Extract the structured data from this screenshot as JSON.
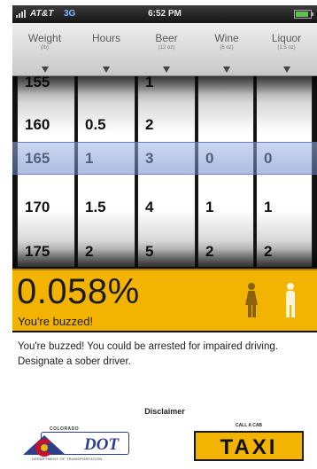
{
  "status_bar": {
    "carrier": "AT&T",
    "network": "3G",
    "time": "6:52 PM"
  },
  "columns": [
    {
      "name": "Weight",
      "unit": "(lb)"
    },
    {
      "name": "Hours",
      "unit": ""
    },
    {
      "name": "Beer",
      "unit": "(12 oz)"
    },
    {
      "name": "Wine",
      "unit": "(6 oz)"
    },
    {
      "name": "Liquor",
      "unit": "(1.5 oz)"
    }
  ],
  "picker": {
    "weight": [
      "155",
      "160",
      "165",
      "170",
      "175"
    ],
    "hours": [
      "",
      "0.5",
      "1",
      "1.5",
      "2"
    ],
    "beer": [
      "1",
      "2",
      "3",
      "4",
      "5"
    ],
    "wine": [
      "",
      "",
      "0",
      "1",
      "2"
    ],
    "liquor": [
      "",
      "",
      "0",
      "1",
      "2"
    ]
  },
  "result": {
    "bac": "0.058%",
    "status": "You're buzzed!",
    "message": "You're buzzed! You could be arrested for impaired driving. Designate a sober driver."
  },
  "footer": {
    "disclaimer": "Disclaimer",
    "dot_logo_top": "COLORADO",
    "dot_logo_text": "DOT",
    "dot_logo_bottom": "DEPARTMENT OF TRANSPORTATION",
    "taxi_top": "CALL A CAB",
    "taxi_text": "TAXI"
  },
  "colors": {
    "bac_panel": "#f2b400",
    "selection_band": "#8aa0d8",
    "dot_blue": "#2b3f8a"
  },
  "icons": [
    "signal-icon",
    "battery-icon",
    "dropdown-arrow-icon",
    "female-icon",
    "male-icon"
  ]
}
